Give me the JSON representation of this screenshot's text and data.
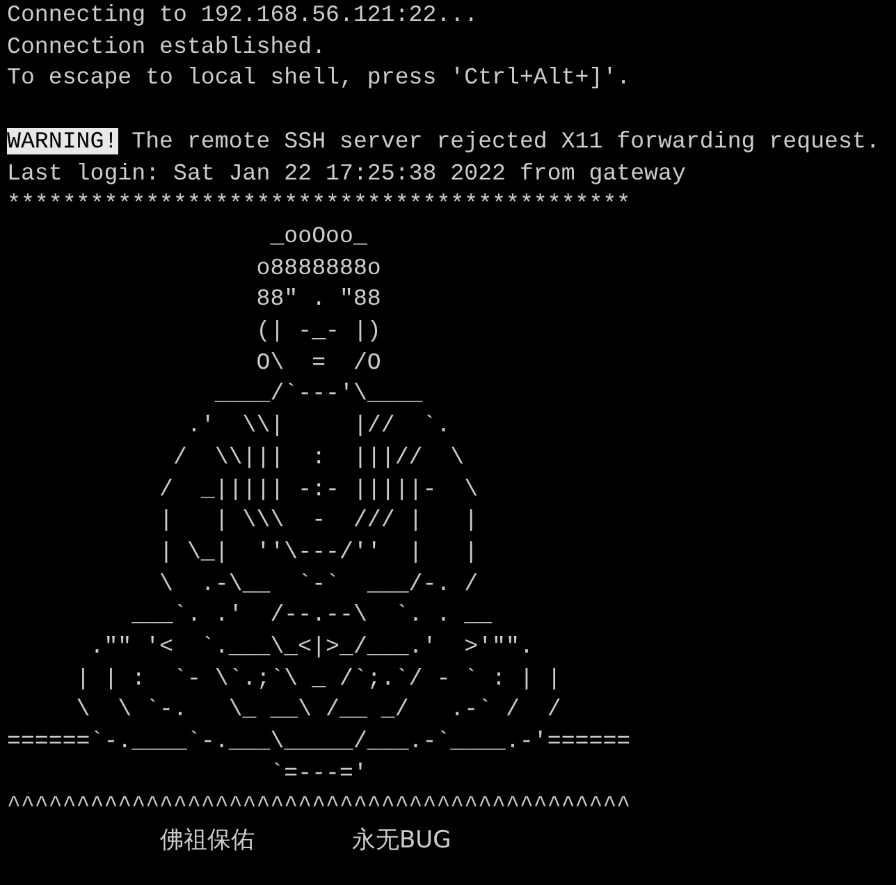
{
  "session_lines": [
    "Connecting to 192.168.56.121:22...",
    "Connection established.",
    "To escape to local shell, press 'Ctrl+Alt+]'."
  ],
  "warning": {
    "label": "WARNING!",
    "message": "The remote SSH server rejected X11 forwarding request."
  },
  "login_line": "Last login: Sat Jan 22 17:25:38 2022 from gateway",
  "banner": [
    "*********************************************",
    "                   _ooOoo_",
    "                  o8888888o",
    "                  88\" . \"88",
    "                  (| -_- |)",
    "                  O\\  =  /O",
    "               ____/`---'\\____",
    "             .'  \\\\|     |//  `.",
    "            /  \\\\|||  :  |||//  \\",
    "           /  _||||| -:- |||||-  \\",
    "           |   | \\\\\\  -  /// |   |",
    "           | \\_|  ''\\---/''  |   |",
    "           \\  .-\\__  `-`  ___/-. /",
    "         ___`. .'  /--.--\\  `. . __",
    "      .\"\" '<  `.___\\_<|>_/___.'  >'\"\".",
    "     | | :  `- \\`.;`\\ _ /`;.`/ - ` : | |",
    "     \\  \\ `-.   \\_ __\\ /__ _/   .-` /  /",
    "======`-.____`-.___\\_____/___.-`____.-'======",
    "                   `=---='",
    "^^^^^^^^^^^^^^^^^^^^^^^^^^^^^^^^^^^^^^^^^^^^^"
  ],
  "blessing": [
    "佛祖保佑",
    "永无BUG"
  ]
}
